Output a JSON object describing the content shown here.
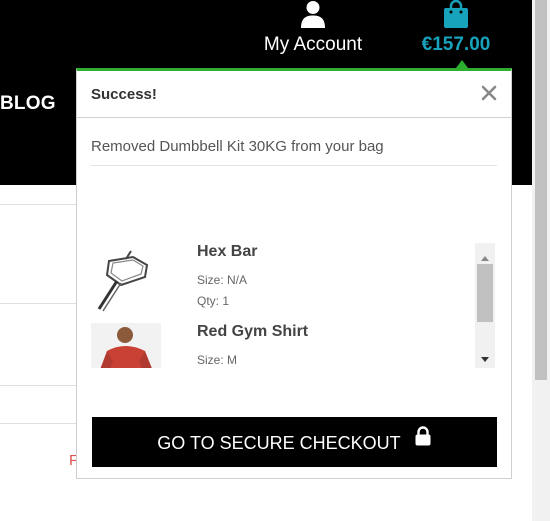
{
  "header": {
    "nav_partial": "BLOG",
    "account_label": "My Account",
    "bag_amount": "€157.00"
  },
  "colors": {
    "header_bg": "#000000",
    "accent_teal": "#17a3bb",
    "success_green": "#2faf2f",
    "checkout_bg": "#000000"
  },
  "background": {
    "partial_red_text": "F"
  },
  "popup": {
    "title": "Success!",
    "close_icon": "close-icon",
    "message": "Removed Dumbbell Kit 30KG from your bag",
    "items": [
      {
        "name": "Hex Bar",
        "size": "Size: N/A",
        "qty": "Qty: 1",
        "image": "hex-bar"
      },
      {
        "name": "Red Gym Shirt",
        "size": "Size: M",
        "image": "red-shirt"
      }
    ],
    "checkout_label": "GO TO SECURE CHECKOUT",
    "checkout_icon": "lock-icon"
  }
}
